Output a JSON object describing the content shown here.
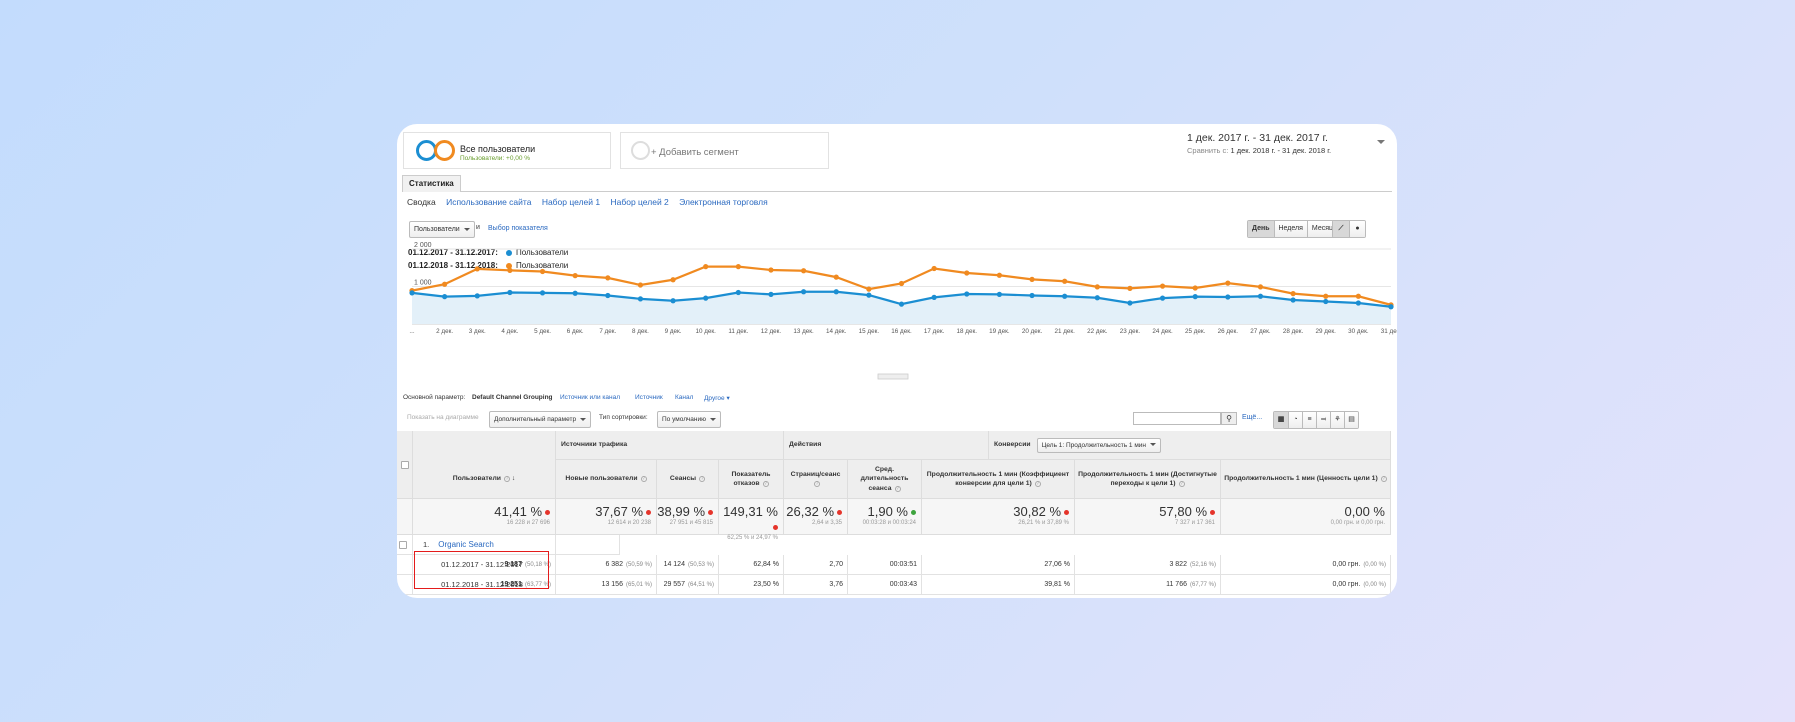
{
  "segments": {
    "seg1_title": "Все пользователи",
    "seg1_sub": "Пользователи: +0,00 %",
    "seg2_label": "+ Добавить сегмент"
  },
  "date_range": {
    "range": "1 дек. 2017 г. - 31 дек. 2017 г.",
    "compare_label": "Сравнить с:",
    "compare_range": "1 дек. 2018 г. - 31 дек. 2018 г."
  },
  "tab": "Статистика",
  "subnav": [
    "Сводка",
    "Использование сайта",
    "Набор целей 1",
    "Набор целей 2",
    "Электронная торговля"
  ],
  "metric_select": "Пользователи",
  "and_label": "и",
  "choose_metric": "Выбор показателя",
  "period_buttons": [
    "День",
    "Неделя",
    "Месяц"
  ],
  "legend": [
    {
      "period": "01.12.2017 - 31.12.2017:",
      "label": "Пользователи",
      "color": "#1b8ed2"
    },
    {
      "period": "01.12.2018 - 31.12.2018:",
      "label": "Пользователи",
      "color": "#f08a20"
    }
  ],
  "chart_data": {
    "type": "line",
    "title": "",
    "x": [
      "...",
      "2 дек.",
      "3 дек.",
      "4 дек.",
      "5 дек.",
      "6 дек.",
      "7 дек.",
      "8 дек.",
      "9 дек.",
      "10 дек.",
      "11 дек.",
      "12 дек.",
      "13 дек.",
      "14 дек.",
      "15 дек.",
      "16 дек.",
      "17 дек.",
      "18 дек.",
      "19 дек.",
      "20 дек.",
      "21 дек.",
      "22 дек.",
      "23 дек.",
      "24 дек.",
      "25 дек.",
      "26 дек.",
      "27 дек.",
      "28 дек.",
      "29 дек.",
      "30 дек.",
      "31 дек."
    ],
    "yticks": [
      "2 000",
      "1 000"
    ],
    "ylim": [
      0,
      2000
    ],
    "grid": true,
    "series": [
      {
        "name": "01.12.2017 - 31.12.2017: Пользователи",
        "color": "#1b8ed2",
        "values": [
          830,
          730,
          750,
          840,
          830,
          820,
          760,
          670,
          620,
          690,
          840,
          790,
          860,
          860,
          770,
          530,
          710,
          800,
          790,
          760,
          740,
          700,
          560,
          690,
          730,
          720,
          740,
          640,
          600,
          560,
          460
        ]
      },
      {
        "name": "01.12.2018 - 31.12.2018: Пользователи",
        "color": "#f08a20",
        "values": [
          890,
          1060,
          1470,
          1430,
          1400,
          1290,
          1230,
          1040,
          1180,
          1530,
          1530,
          1440,
          1420,
          1250,
          930,
          1080,
          1480,
          1360,
          1300,
          1190,
          1140,
          990,
          950,
          1010,
          960,
          1090,
          990,
          810,
          740,
          740,
          510
        ]
      }
    ]
  },
  "dimension": {
    "label": "Основной параметр:",
    "active": "Default Channel Grouping",
    "options": [
      "Источник или канал",
      "Источник",
      "Канал",
      "Другое"
    ]
  },
  "toolbar": {
    "plot_rows": "Показать на диаграмме",
    "secondary": "Дополнительный параметр",
    "sort_label": "Тип сортировки:",
    "sort_value": "По умолчанию",
    "more": "Ещё..."
  },
  "table": {
    "col_dim": "Default Channel Grouping",
    "groups": [
      "Источники трафика",
      "Действия",
      "Конверсии"
    ],
    "goal_select": "Цель 1: Продолжительность 1 мин",
    "headers": [
      "Пользователи",
      "Новые пользователи",
      "Сеансы",
      "Показатель отказов",
      "Страниц/сеанс",
      "Сред. длительность сеанса",
      "Продолжительность 1 мин (Коэффициент конверсии для цели 1)",
      "Продолжительность 1 мин (Достигнутые переходы к цели 1)",
      "Продолжительность 1 мин (Ценность цели 1)"
    ],
    "totals": [
      {
        "v": "41,41 %",
        "s": "16 228 и 27 696",
        "d": "red"
      },
      {
        "v": "37,67 %",
        "s": "12 614 и 20 238",
        "d": "red"
      },
      {
        "v": "38,99 %",
        "s": "27 951 и 45 815",
        "d": "red"
      },
      {
        "v": "149,31 %",
        "s": "62,25 % и 24,97 %",
        "d": "red"
      },
      {
        "v": "26,32 %",
        "s": "2,64 и 3,35",
        "d": "red"
      },
      {
        "v": "1,90 %",
        "s": "00:03:28 и 00:03:24",
        "d": "green"
      },
      {
        "v": "30,82 %",
        "s": "26,21 % и 37,89 %",
        "d": "red"
      },
      {
        "v": "57,80 %",
        "s": "7 327 и 17 361",
        "d": "red"
      },
      {
        "v": "0,00 %",
        "s": "0,00 грн. и 0,00 грн.",
        "d": ""
      }
    ],
    "group_row": {
      "num": "1.",
      "label": "Organic Search"
    },
    "rows": [
      {
        "period": "01.12.2017 - 31.12.2017",
        "cells": [
          [
            "9 187",
            "(50,18 %)"
          ],
          [
            "6 382",
            "(50,59 %)"
          ],
          [
            "14 124",
            "(50,53 %)"
          ],
          [
            "62,84 %",
            ""
          ],
          [
            "2,70",
            ""
          ],
          [
            "00:03:51",
            ""
          ],
          [
            "27,06 %",
            ""
          ],
          [
            "3 822",
            "(52,16 %)"
          ],
          [
            "0,00 грн.",
            "(0,00 %)"
          ]
        ]
      },
      {
        "period": "01.12.2018 - 31.12.2018",
        "cells": [
          [
            "19 251",
            "(63,77 %)"
          ],
          [
            "13 156",
            "(65,01 %)"
          ],
          [
            "29 557",
            "(64,51 %)"
          ],
          [
            "23,50 %",
            ""
          ],
          [
            "3,76",
            ""
          ],
          [
            "00:03:43",
            ""
          ],
          [
            "39,81 %",
            ""
          ],
          [
            "11 766",
            "(67,77 %)"
          ],
          [
            "0,00 грн.",
            "(0,00 %)"
          ]
        ]
      }
    ]
  }
}
